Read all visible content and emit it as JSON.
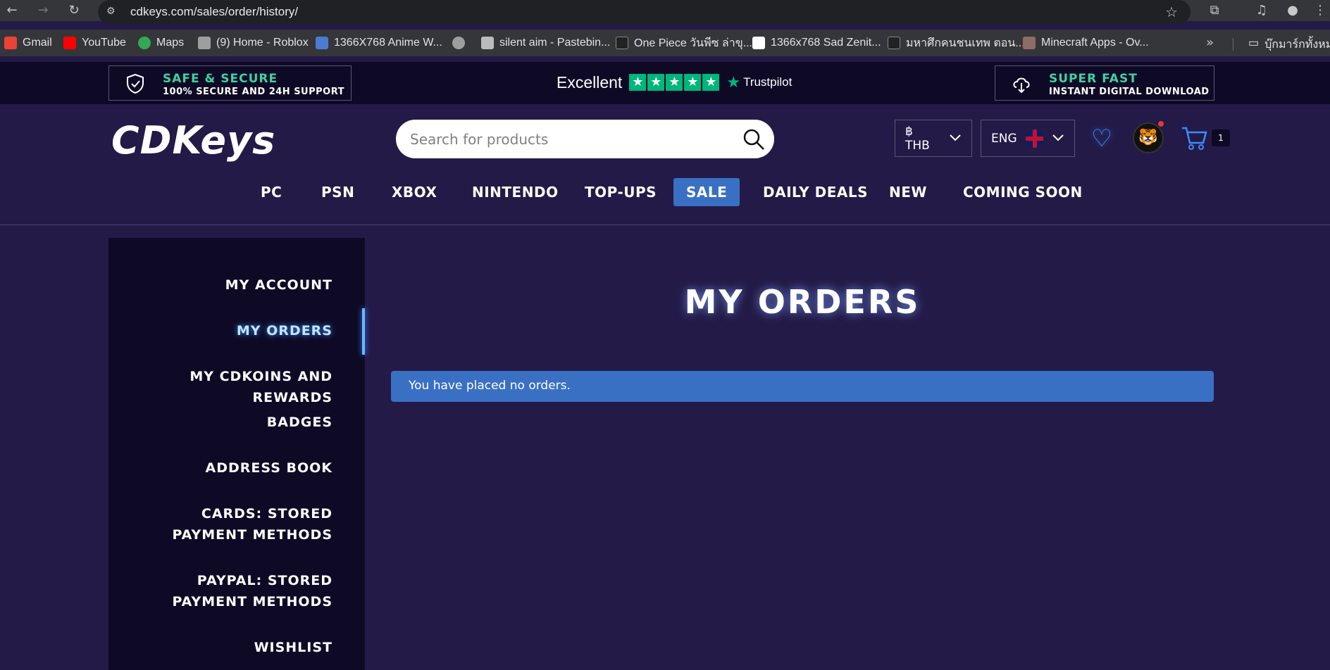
{
  "browser": {
    "url": "cdkeys.com/sales/order/history/",
    "bookmarks": [
      {
        "label": "Gmail",
        "color": "#ea4335"
      },
      {
        "label": "YouTube",
        "color": "#ff0000"
      },
      {
        "label": "Maps",
        "color": "#34a853"
      },
      {
        "label": "(9) Home - Roblox",
        "color": "#9e9e9e"
      },
      {
        "label": "1366X768 Anime W...",
        "color": "#4a7bd0"
      },
      {
        "label": "",
        "color": "#9e9e9e"
      },
      {
        "label": "silent aim - Pastebin...",
        "color": "#bbbbbb"
      },
      {
        "label": "One Piece วันพีซ ล่าขุ...",
        "color": "#222222"
      },
      {
        "label": "1366x768 Sad Zenit...",
        "color": "#ffffff"
      },
      {
        "label": "มหาศึกคนชนเทพ ตอน...",
        "color": "#222222"
      },
      {
        "label": "Minecraft Apps - Ov...",
        "color": "#8d6e63"
      }
    ],
    "folder_label": "บุ๊กมาร์กทั้งหมด"
  },
  "trust": {
    "left_title": "SAFE & SECURE",
    "left_sub": "100% SECURE AND 24H SUPPORT",
    "rating_word": "Excellent",
    "brand": "Trustpilot",
    "right_title": "SUPER FAST",
    "right_sub": "INSTANT DIGITAL DOWNLOAD"
  },
  "header": {
    "logo": "CDKeys",
    "search_placeholder": "Search for products",
    "currency": "฿ THB",
    "language": "ENG",
    "cart_count": "1"
  },
  "menu": [
    "PC",
    "PSN",
    "XBOX",
    "NINTENDO",
    "TOP-UPS",
    "SALE",
    "DAILY DEALS",
    "NEW",
    "COMING SOON"
  ],
  "sidebar": {
    "items": [
      "MY ACCOUNT",
      "MY ORDERS",
      "MY CDKOINS AND REWARDS",
      "BADGES",
      "ADDRESS BOOK",
      "CARDS: STORED PAYMENT METHODS",
      "PAYPAL: STORED PAYMENT METHODS",
      "WISHLIST"
    ]
  },
  "main": {
    "title": "MY ORDERS",
    "notice": "You have placed no orders."
  },
  "colors": {
    "page_bg": "#231a47",
    "strip_bg": "#0e0a26",
    "accent_blue": "#3a70c4",
    "trust_green": "#3dd3a2",
    "tp_green": "#00b67a"
  }
}
